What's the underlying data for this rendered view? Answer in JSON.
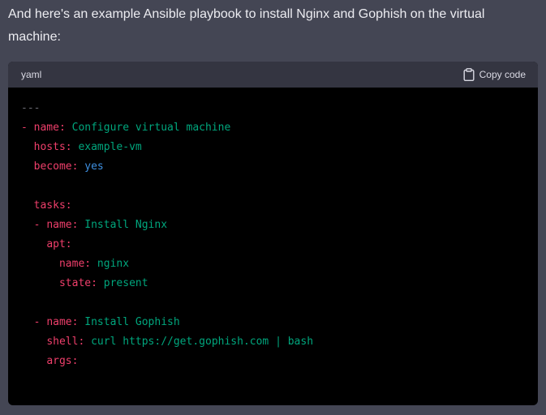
{
  "message": {
    "intro_text": "And here's an example Ansible playbook to install Nginx and Gophish on the virtual machine:"
  },
  "code_block": {
    "language": "yaml",
    "copy_label": "Copy code",
    "copy_icon": "clipboard-icon",
    "lines": {
      "l1": {
        "indent": "",
        "dash": "---"
      },
      "l2": {
        "indent": "",
        "bullet": "- ",
        "key": "name:",
        "value": " Configure virtual machine"
      },
      "l3": {
        "indent": "  ",
        "key": "hosts:",
        "value": " example-vm"
      },
      "l4": {
        "indent": "  ",
        "key": "become:",
        "value": " yes"
      },
      "l6": {
        "indent": "  ",
        "key": "tasks:"
      },
      "l7": {
        "indent": "  ",
        "bullet": "- ",
        "key": "name:",
        "value": " Install Nginx"
      },
      "l8": {
        "indent": "    ",
        "key": "apt:"
      },
      "l9": {
        "indent": "      ",
        "key": "name:",
        "value": " nginx"
      },
      "l10": {
        "indent": "      ",
        "key": "state:",
        "value": " present"
      },
      "l12": {
        "indent": "  ",
        "bullet": "- ",
        "key": "name:",
        "value": " Install Gophish"
      },
      "l13": {
        "indent": "    ",
        "key": "shell:",
        "value": " curl https://get.gophish.com | bash"
      },
      "l14": {
        "indent": "    ",
        "key": "args:"
      }
    }
  },
  "colors": {
    "page_background": "#444654",
    "code_header_background": "#343541",
    "code_background": "#000000",
    "yaml_key": "#ef3f6b",
    "yaml_string": "#00a67d",
    "yaml_boolean": "#3e8fe0"
  }
}
